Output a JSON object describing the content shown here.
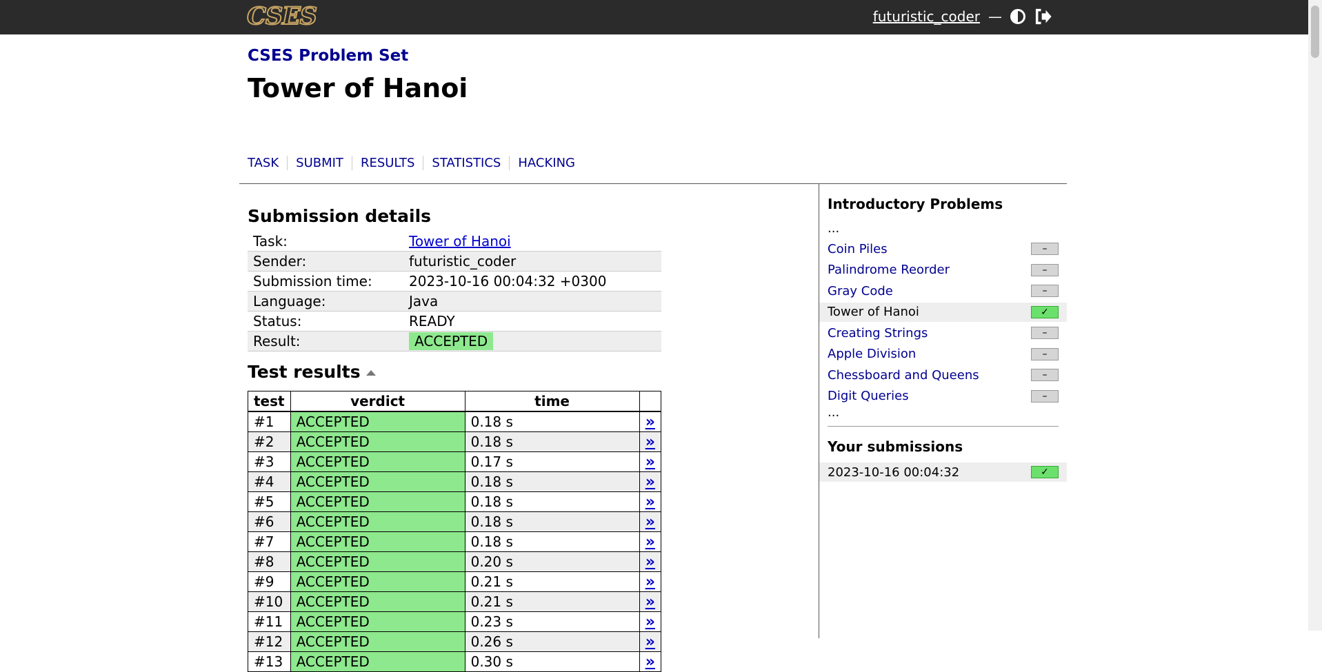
{
  "header": {
    "logo_text": "CSES",
    "username": "futuristic_coder",
    "separator": "—",
    "icons": [
      "contrast-icon",
      "logout-icon"
    ]
  },
  "crumb": "CSES Problem Set",
  "title": "Tower of Hanoi",
  "tabs": [
    "TASK",
    "SUBMIT",
    "RESULTS",
    "STATISTICS",
    "HACKING"
  ],
  "details": {
    "heading": "Submission details",
    "rows": [
      {
        "key": "Task:",
        "value": "Tower of Hanoi"
      },
      {
        "key": "Sender:",
        "value": "futuristic_coder"
      },
      {
        "key": "Submission time:",
        "value": "2023-10-16 00:04:32 +0300"
      },
      {
        "key": "Language:",
        "value": "Java"
      },
      {
        "key": "Status:",
        "value": "READY"
      },
      {
        "key": "Result:",
        "value": "ACCEPTED"
      }
    ]
  },
  "tests": {
    "heading": "Test results",
    "columns": [
      "test",
      "verdict",
      "time",
      ""
    ],
    "link_glyph": "»",
    "rows": [
      {
        "test": "#1",
        "verdict": "ACCEPTED",
        "time": "0.18 s"
      },
      {
        "test": "#2",
        "verdict": "ACCEPTED",
        "time": "0.18 s"
      },
      {
        "test": "#3",
        "verdict": "ACCEPTED",
        "time": "0.17 s"
      },
      {
        "test": "#4",
        "verdict": "ACCEPTED",
        "time": "0.18 s"
      },
      {
        "test": "#5",
        "verdict": "ACCEPTED",
        "time": "0.18 s"
      },
      {
        "test": "#6",
        "verdict": "ACCEPTED",
        "time": "0.18 s"
      },
      {
        "test": "#7",
        "verdict": "ACCEPTED",
        "time": "0.18 s"
      },
      {
        "test": "#8",
        "verdict": "ACCEPTED",
        "time": "0.20 s"
      },
      {
        "test": "#9",
        "verdict": "ACCEPTED",
        "time": "0.21 s"
      },
      {
        "test": "#10",
        "verdict": "ACCEPTED",
        "time": "0.21 s"
      },
      {
        "test": "#11",
        "verdict": "ACCEPTED",
        "time": "0.23 s"
      },
      {
        "test": "#12",
        "verdict": "ACCEPTED",
        "time": "0.26 s"
      },
      {
        "test": "#13",
        "verdict": "ACCEPTED",
        "time": "0.30 s"
      }
    ]
  },
  "sidebar": {
    "heading": "Introductory Problems",
    "ellipsis": "...",
    "problems": [
      {
        "name": "Coin Piles",
        "status": "none",
        "mark": "–"
      },
      {
        "name": "Palindrome Reorder",
        "status": "none",
        "mark": "–"
      },
      {
        "name": "Gray Code",
        "status": "none",
        "mark": "–"
      },
      {
        "name": "Tower of Hanoi",
        "status": "solved",
        "mark": "✓"
      },
      {
        "name": "Creating Strings",
        "status": "none",
        "mark": "–"
      },
      {
        "name": "Apple Division",
        "status": "none",
        "mark": "–"
      },
      {
        "name": "Chessboard and Queens",
        "status": "none",
        "mark": "–"
      },
      {
        "name": "Digit Queries",
        "status": "none",
        "mark": "–"
      }
    ],
    "submissions_heading": "Your submissions",
    "submissions": [
      {
        "time": "2023-10-16 00:04:32",
        "status": "solved",
        "mark": "✓"
      }
    ]
  },
  "colors": {
    "topbar": "#2b2b2b",
    "logo": "#c8a464",
    "link": "#000090",
    "accepted": "#8ee88e",
    "solved_mark": "#6ce06c"
  }
}
